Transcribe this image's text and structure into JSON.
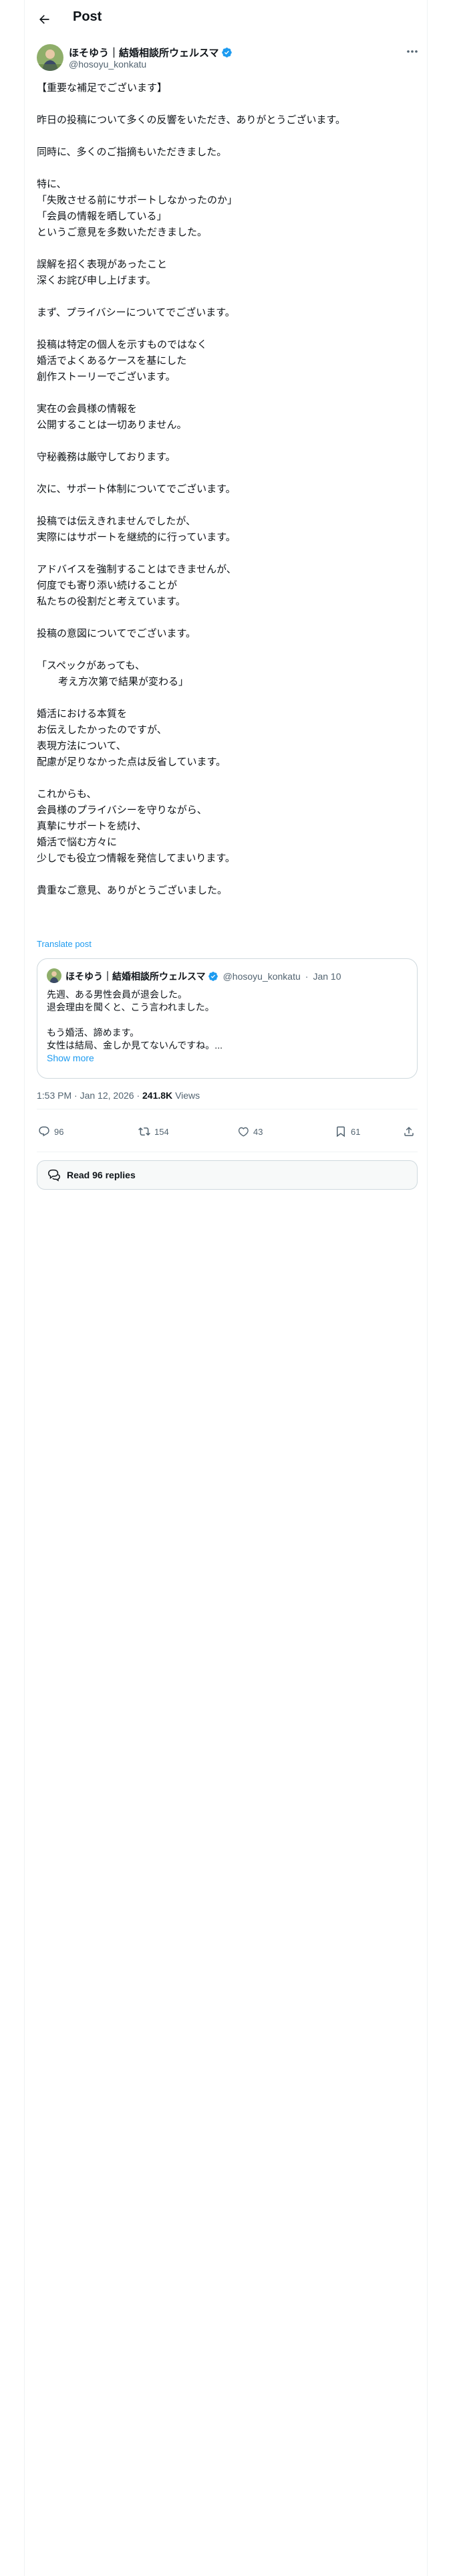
{
  "header": {
    "title": "Post",
    "back_icon": "arrow-left-icon"
  },
  "author": {
    "name": "ほそゆう｜結婚相談所ウェルスマ",
    "handle": "@hosoyu_konkatu",
    "verified_color": "#1d9bf0"
  },
  "post": {
    "paragraphs": [
      [
        "【重要な補足でございます】"
      ],
      [
        "昨日の投稿について多くの反響をいただき、ありがとうございます。"
      ],
      [
        "同時に、多くのご指摘もいただきました。"
      ],
      [
        "特に、",
        "「失敗させる前にサポートしなかったのか」",
        "「会員の情報を晒している」",
        "というご意見を多数いただきました。"
      ],
      [
        "誤解を招く表現があったこと",
        "深くお詫び申し上げます。"
      ],
      [
        "まず、プライバシーについてでございます。"
      ],
      [
        "投稿は特定の個人を示すものではなく",
        "婚活でよくあるケースを基にした",
        "創作ストーリーでございます。"
      ],
      [
        "実在の会員様の情報を",
        "公開することは一切ありません。"
      ],
      [
        "守秘義務は厳守しております。"
      ],
      [
        "次に、サポート体制についてでございます。"
      ],
      [
        "投稿では伝えきれませんでしたが、",
        "実際にはサポートを継続的に行っています。"
      ],
      [
        "アドバイスを強制することはできませんが、",
        "何度でも寄り添い続けることが",
        "私たちの役割だと考えています。"
      ],
      [
        "投稿の意図についてでございます。"
      ],
      [
        "「スペックがあっても、",
        "考え方次第で結果が変わる」"
      ],
      [
        "婚活における本質を",
        "お伝えしたかったのですが、",
        "表現方法について、",
        "配慮が足りなかった点は反省しています。"
      ],
      [
        "これからも、",
        "会員様のプライバシーを守りながら、",
        "真摯にサポートを続け、",
        "婚活で悩む方々に",
        "少しでも役立つ情報を発信してまいります。"
      ],
      [
        "貴重なご意見、ありがとうございました。"
      ]
    ],
    "translate_label": "Translate post"
  },
  "quote": {
    "author_name": "ほそゆう｜結婚相談所ウェルスマ",
    "author_handle": "@hosoyu_konkatu",
    "date": "Jan 10",
    "separator": "·",
    "lines": [
      "先週、ある男性会員が退会した。",
      "退会理由を聞くと、こう言われました。",
      "",
      "もう婚活、諦めます。",
      "女性は結局、金しか見てないんですね。..."
    ],
    "show_more": "Show more"
  },
  "meta": {
    "time": "1:53 PM",
    "dot": "·",
    "date": "Jan 12, 2026",
    "views_count": "241.8K",
    "views_label": "Views"
  },
  "actions": {
    "replies": "96",
    "reposts": "154",
    "likes": "43",
    "bookmarks": "61"
  },
  "read_replies": {
    "label": "Read 96 replies"
  }
}
